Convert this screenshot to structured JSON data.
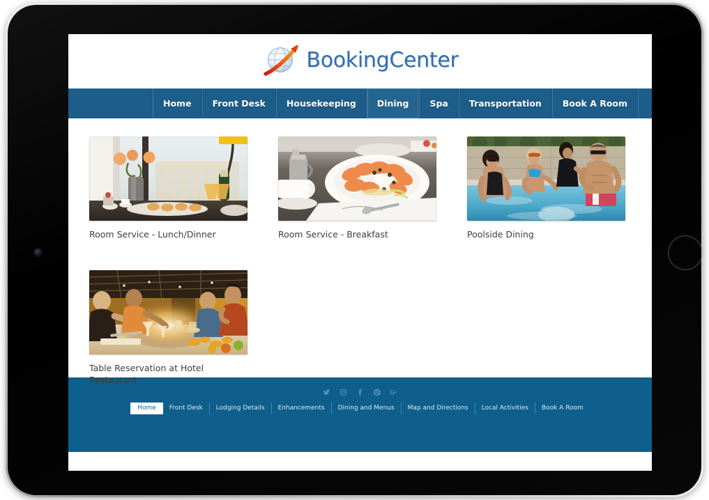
{
  "device": {
    "type": "tablet",
    "camera": "front-camera",
    "home_button": "home-button"
  },
  "site": {
    "logo_text": "BookingCenter",
    "logo_mark": "globe-arrow-logo",
    "logo_color": "#2f6fb5",
    "accent_color": "#1c5d8a",
    "footer_color": "#0e5f8c"
  },
  "nav": {
    "items": [
      {
        "label": "Home",
        "active": false
      },
      {
        "label": "Front Desk",
        "active": false
      },
      {
        "label": "Housekeeping",
        "active": false
      },
      {
        "label": "Dining",
        "active": true
      },
      {
        "label": "Spa",
        "active": false
      },
      {
        "label": "Transportation",
        "active": false
      },
      {
        "label": "Book A Room",
        "active": false
      }
    ],
    "search_icon": "search-icon"
  },
  "main": {
    "cards": [
      {
        "caption": "Room Service - Lunch/Dinner",
        "image": "balcony-breakfast-table-with-flowers-and-champagne"
      },
      {
        "caption": "Room Service - Breakfast",
        "image": "smoked-salmon-plate-with-coffee-cup"
      },
      {
        "caption": "Poolside Dining",
        "image": "guests-relaxing-in-swimming-pool"
      },
      {
        "caption": "Table Reservation at Hotel Restaurant",
        "image": "guests-dining-at-restaurant-table"
      }
    ]
  },
  "footer": {
    "social": [
      {
        "name": "twitter-icon"
      },
      {
        "name": "instagram-icon"
      },
      {
        "name": "facebook-icon"
      },
      {
        "name": "pinterest-icon"
      },
      {
        "name": "google-plus-icon"
      }
    ],
    "links": [
      {
        "label": "Home",
        "active": true
      },
      {
        "label": "Front Desk",
        "active": false
      },
      {
        "label": "Lodging Details",
        "active": false
      },
      {
        "label": "Enhancements",
        "active": false
      },
      {
        "label": "Dining and Menus",
        "active": false
      },
      {
        "label": "Map and Directions",
        "active": false
      },
      {
        "label": "Local Activities",
        "active": false
      },
      {
        "label": "Book A Room",
        "active": false
      }
    ]
  }
}
